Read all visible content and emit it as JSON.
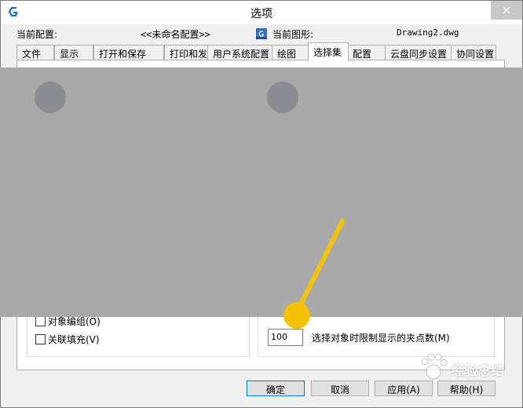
{
  "window": {
    "title": "选项"
  },
  "profile": {
    "current_profile_label": "当前配置:",
    "current_profile_value": "<<未命名配置>>",
    "current_drawing_label": "当前图形:",
    "current_drawing_value": "Drawing2.dwg"
  },
  "tabs": [
    {
      "label": "文件",
      "active": false
    },
    {
      "label": "显示",
      "active": false
    },
    {
      "label": "打开和保存",
      "active": false
    },
    {
      "label": "打印和发布",
      "active": false
    },
    {
      "label": "用户系统配置",
      "active": false
    },
    {
      "label": "绘图",
      "active": false
    },
    {
      "label": "选择集",
      "active": true
    },
    {
      "label": "配置",
      "active": false
    },
    {
      "label": "云盘同步设置",
      "active": false
    },
    {
      "label": "协同设置",
      "active": false
    }
  ],
  "left_group": {
    "object_group_label": "对象编组(O)",
    "object_group_checked": false,
    "assoc_hatch_label": "关联填充(V)",
    "assoc_hatch_checked": false
  },
  "right_group": {
    "grip_limit_value": "100",
    "grip_limit_label": "选择对象时限制显示的夹点数(M)"
  },
  "buttons": {
    "ok": "确定",
    "cancel": "取消",
    "apply": "应用(A)",
    "help": "帮助(H)"
  },
  "watermark": {
    "text": "经验总结"
  },
  "colors": {
    "accent": "#0078d7",
    "pointer": "#f5c20a",
    "blur": "#a9a9a9"
  }
}
